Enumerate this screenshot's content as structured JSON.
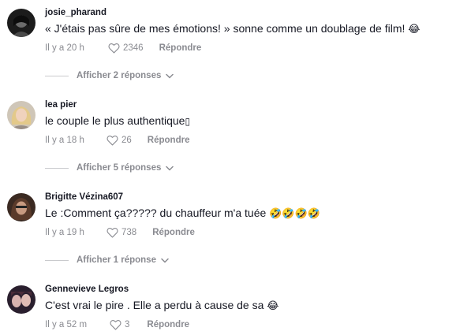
{
  "comments": [
    {
      "username": "josie_pharand",
      "text": "« J'étais pas sûre de mes émotions! » sonne comme un doublage de film! ",
      "emoji": "😂",
      "time": "Il y a 20 h",
      "likes": "2346",
      "reply_label": "Répondre",
      "replies_label": "Afficher 2 réponses"
    },
    {
      "username": "lea pier",
      "text": "le couple le plus authentique",
      "emoji": "▯",
      "time": "Il y a 18 h",
      "likes": "26",
      "reply_label": "Répondre",
      "replies_label": "Afficher 5 réponses"
    },
    {
      "username": "Brigitte Vézina607",
      "text": "Le :Comment ça????? du chauffeur m'a tuée ",
      "emoji": "🤣🤣🤣🤣",
      "time": "Il y a 19 h",
      "likes": "738",
      "reply_label": "Répondre",
      "replies_label": "Afficher 1 réponse"
    },
    {
      "username": "Gennevieve Legros",
      "text": "C'est vrai le pire . Elle a perdu à cause de sa ",
      "emoji": "😂",
      "time": "Il y a 52 m",
      "likes": "3",
      "reply_label": "Répondre"
    }
  ],
  "colors": {
    "text_primary": "#161823",
    "text_secondary": "#8a8b91",
    "emoji_face": "#f5b82e",
    "tear": "#4aa3df"
  },
  "icons": [
    "heart-outline-icon",
    "chevron-down-icon"
  ]
}
